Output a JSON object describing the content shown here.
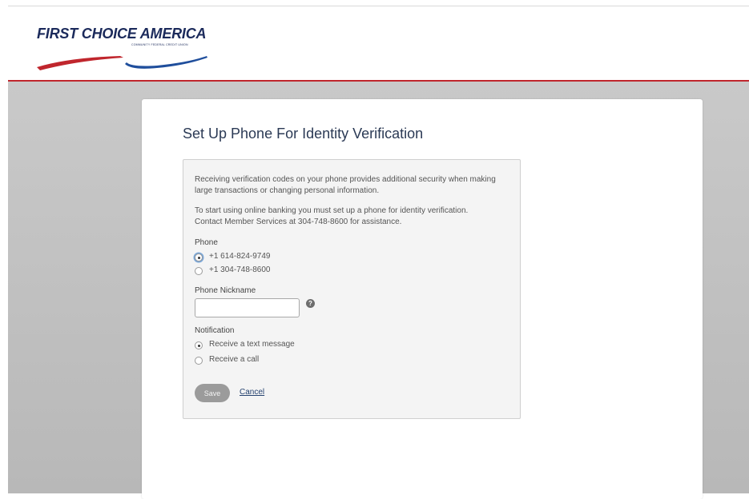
{
  "brand": {
    "name": "FIRST CHOICE AMERICA",
    "subtitle": "COMMUNITY FEDERAL CREDIT UNION",
    "colors": {
      "navy": "#1b2a5b",
      "red": "#c0262d",
      "blue": "#1f4e9c"
    }
  },
  "page": {
    "title": "Set Up Phone For Identity Verification"
  },
  "intro": {
    "line1": "Receiving verification codes on your phone provides additional security when making",
    "line2": "large transactions or changing personal information.",
    "line3": "To start using online banking you must set up a phone for identity verification.",
    "line4": "Contact Member Services at 304-748-8600 for assistance."
  },
  "phone": {
    "label": "Phone",
    "options": [
      {
        "label": "+1 614-824-9749",
        "selected": true
      },
      {
        "label": "+1 304-748-8600",
        "selected": false
      }
    ]
  },
  "nickname": {
    "label": "Phone Nickname",
    "value": "",
    "placeholder": "",
    "help_icon": "question-circle-icon",
    "help_glyph": "?"
  },
  "notification": {
    "label": "Notification",
    "options": [
      {
        "label": "Receive a text message",
        "selected": true
      },
      {
        "label": "Receive a call",
        "selected": false
      }
    ]
  },
  "actions": {
    "save_label": "Save",
    "cancel_label": "Cancel"
  }
}
